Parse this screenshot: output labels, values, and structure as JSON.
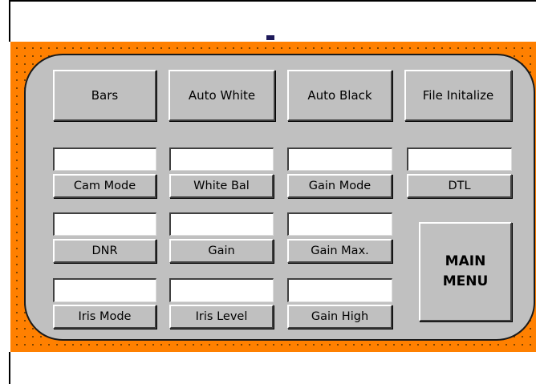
{
  "top_glyph": "ʻʻ̦̦",
  "buttons": {
    "bars": "Bars",
    "auto_white": "Auto White",
    "auto_black": "Auto Black",
    "file_initialize": "File Initalize"
  },
  "controls": [
    {
      "label": "Cam Mode",
      "value": ""
    },
    {
      "label": "White Bal",
      "value": ""
    },
    {
      "label": "Gain Mode",
      "value": ""
    },
    {
      "label": "DTL",
      "value": ""
    },
    {
      "label": "DNR",
      "value": ""
    },
    {
      "label": "Gain",
      "value": ""
    },
    {
      "label": "Gain Max.",
      "value": ""
    },
    {
      "label": "Iris Mode",
      "value": ""
    },
    {
      "label": "Iris Level",
      "value": ""
    },
    {
      "label": "Gain High",
      "value": ""
    }
  ],
  "main_menu": {
    "line1": "MAIN",
    "line2": "MENU"
  },
  "colors": {
    "background_border": "#ff8000",
    "panel": "#c0c0c0"
  }
}
